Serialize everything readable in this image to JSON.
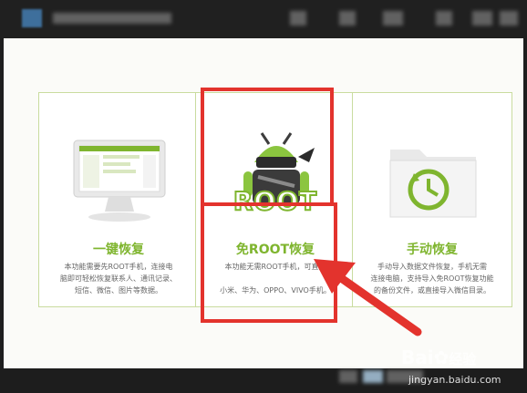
{
  "window": {
    "title_obscured": true
  },
  "cards": [
    {
      "title": "一键恢复",
      "desc_lines": [
        "本功能需要先ROOT手机，连接电",
        "脑即可轻松恢复联系人、通讯记录、",
        "短信、微信、图片等数据。"
      ]
    },
    {
      "title": "免ROOT恢复",
      "badge_text": "ROOT",
      "desc_lines": [
        "本功能无需ROOT手机，可直接",
        "小米、华为、OPPO、VIVO手机。"
      ]
    },
    {
      "title": "手动恢复",
      "desc_lines": [
        "手动导入数据文件恢复，手机无需",
        "连接电脑，支持导入免ROOT恢复功能",
        "的备份文件，或直接导入微信目录。"
      ]
    }
  ],
  "watermark": {
    "brand": "Bai",
    "brand2": "经验",
    "url": "jingyan.baidu.com"
  },
  "colors": {
    "accent_green": "#7fb52f",
    "highlight_red": "#e3332d",
    "titlebar": "#202020"
  }
}
